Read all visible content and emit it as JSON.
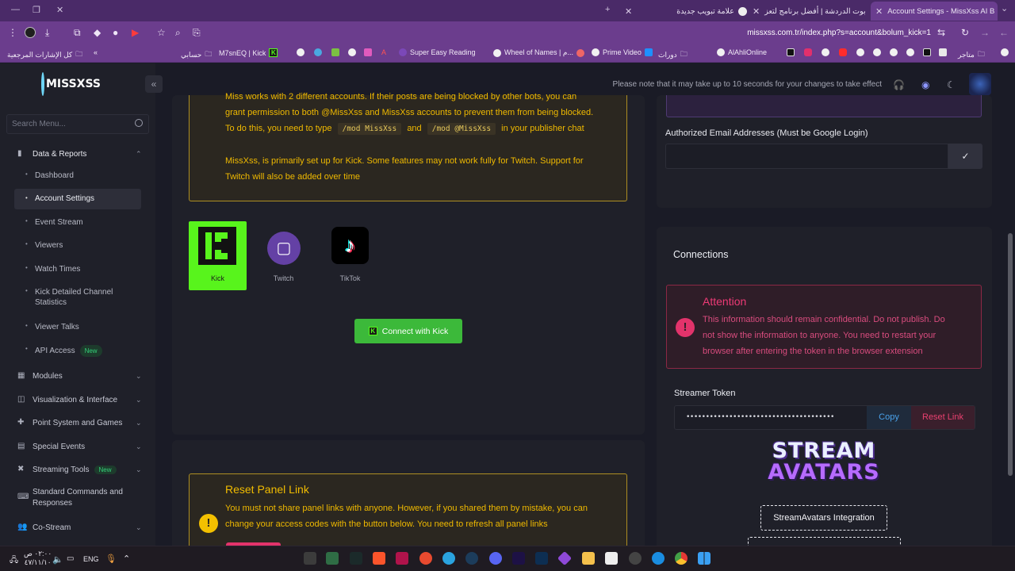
{
  "browser": {
    "tabs": [
      {
        "title": "Account Settings - MissXss AI B",
        "active": true
      },
      {
        "title": "بوت الدردشة | أفضل برنامج لتعز"
      },
      {
        "title": "علامة تبويب جديدة"
      }
    ],
    "url": "missxss.com.tr/index.php?s=account&bolum_kick=1",
    "bookmarks": [
      "كل الإشارات المرجعية",
      "حسابي",
      "M7snEQ | Kick",
      "Super Easy Reading",
      "Wheel of Names | م...",
      "Prime Video",
      "دورات",
      "AlAhliOnline",
      "متاجر"
    ]
  },
  "header": {
    "logo_text": "MISSXSS",
    "note": "Please note that it may take up to 10 seconds for your changes to take effect"
  },
  "sidebar": {
    "search_placeholder": "Search Menu...",
    "section": "Data & Reports",
    "sub_items": [
      "Dashboard",
      "Account Settings",
      "Event Stream",
      "Viewers",
      "Watch Times",
      "Kick Detailed Channel Statistics",
      "Viewer Talks",
      "API Access"
    ],
    "new_badge": "New",
    "menu_items": [
      "Modules",
      "Visualization & Interface",
      "Point System and Games",
      "Special Events",
      "Streaming Tools",
      "Standard Commands and Responses",
      "Co-Stream"
    ]
  },
  "main": {
    "warning_line1": "Miss works with 2 different accounts. If their posts are being blocked by other bots, you can",
    "warning_line2": "grant permission to both @MissXss and MissXss accounts to prevent them from being blocked.",
    "warning_line3_a": "To do this, you need to type",
    "mod_cmd1": "/mod MissXss",
    "and_word": "and",
    "mod_cmd2": "/mod @MissXss",
    "warning_line3_b": "in your publisher chat",
    "warning_line4": "MissXss, is primarily set up for Kick. Some features may not work fully for Twitch. Support for",
    "warning_line5": "Twitch will also be added over time",
    "platforms": [
      "Kick",
      "Twitch",
      "TikTok"
    ],
    "connect_button": "Connect with Kick",
    "reset_title": "Reset Panel Link",
    "reset_line1": "You must not share panel links with anyone. However, if you shared them by mistake, you can",
    "reset_line2": "change your access codes with the button below. You need to refresh all panel links"
  },
  "right": {
    "authorized_label": "Authorized Email Addresses (Must be Google Login)",
    "connections_title": "Connections",
    "attention_title": "Attention",
    "attention_line1": "This information should remain confidential. Do not publish. Do",
    "attention_line2": "not show the information to anyone. You need to restart your",
    "attention_line3": "browser after entering the token in the browser extension",
    "streamer_token_label": "Streamer Token",
    "token_value": "••••••••••••••••••••••••••••••••••••••",
    "copy_button": "Copy",
    "reset_link_button": "Reset Link",
    "stream_avatars_logo_top": "STREAM",
    "stream_avatars_logo_bottom": "AVATARS",
    "stream_avatars_button": "StreamAvatars Integration"
  },
  "taskbar": {
    "time": "٠٢:٠٠ ص",
    "date": "٤٧/١١/١٠",
    "lang": "ENG"
  }
}
